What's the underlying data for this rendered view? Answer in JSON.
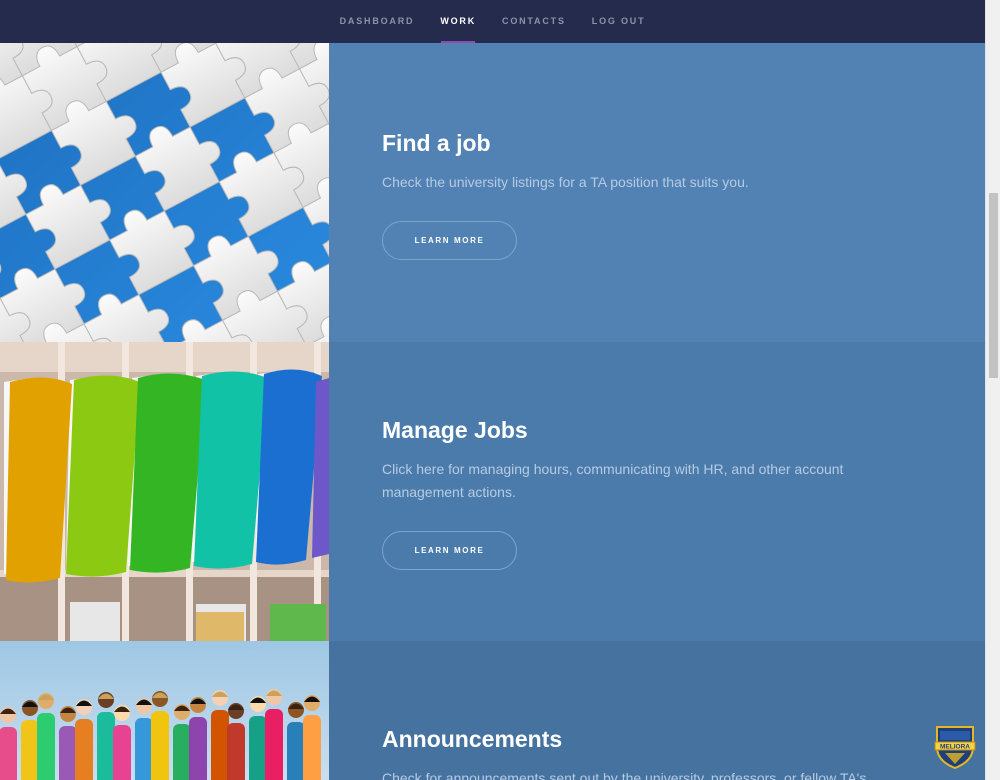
{
  "nav": {
    "items": [
      {
        "label": "DASHBOARD",
        "active": false
      },
      {
        "label": "WORK",
        "active": true
      },
      {
        "label": "CONTACTS",
        "active": false
      },
      {
        "label": "LOG OUT",
        "active": false
      }
    ]
  },
  "sections": [
    {
      "title": "Find a job",
      "description": "Check the university listings for a TA position that suits you.",
      "button_label": "LEARN MORE",
      "image": "puzzle-pieces"
    },
    {
      "title": "Manage Jobs",
      "description": "Click here for managing hours, communicating with HR, and other account management actions.",
      "button_label": "LEARN MORE",
      "image": "colorful-folders"
    },
    {
      "title": "Announcements",
      "description": "Check for announcements sent out by the university, professors, or fellow TA's.",
      "image": "group-of-students"
    }
  ],
  "seal": {
    "text": "MELIORA"
  },
  "colors": {
    "nav_bg": "#252b4d",
    "nav_active_underline": "#8a4fb0",
    "section_1_bg": "#5182b3",
    "section_2_bg": "#4b7bab",
    "section_3_bg": "#46729f"
  }
}
